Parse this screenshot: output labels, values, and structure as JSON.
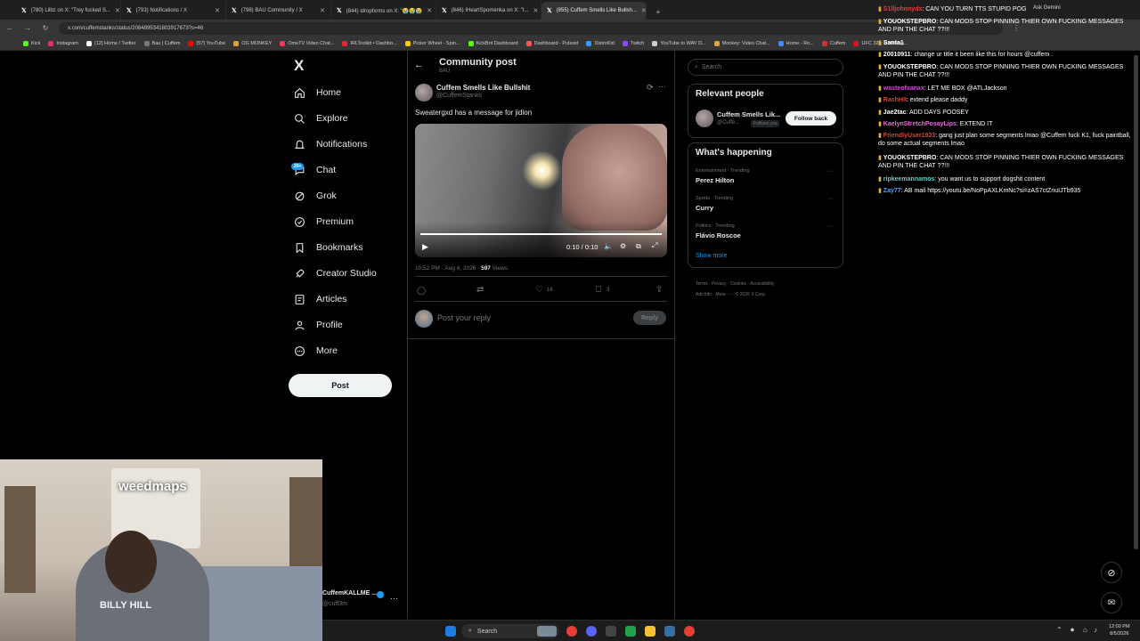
{
  "browser": {
    "tabs": [
      {
        "label": "(780) Lilbz on X: \"Trey fucked S...",
        "active": false
      },
      {
        "label": "(793) Notifications / X",
        "active": false
      },
      {
        "label": "(798) BAU Community / X",
        "active": false
      },
      {
        "label": "(844) idropfxrms on X: \"😭😭😭",
        "active": false
      },
      {
        "label": "(846) IHeartSpomenka on X: \"I...",
        "active": false
      },
      {
        "label": "(855) Cuffem Smells Like Bullsh...",
        "active": true
      }
    ],
    "url": "x.com/cuffemstanks/status/2084895341803917673?s=46",
    "bookmarks": [
      "Kick",
      "Instagram",
      "(12) Home / Twitter",
      "Bau | Cuffem",
      "(57) YouTube",
      "OG MONKEY",
      "OmeTV Video Chat...",
      "IRLToolkit • Dashbo...",
      "Picker Wheel - Spin...",
      "KickBot Dashboard",
      "Dashboard - Pulsoid",
      "DistroKid",
      "Twitch",
      "YouTube to WAV D...",
      "Monkey: Video Chat...",
      "Home - Ro...",
      "Cuffem",
      "UFC 326: Holloway..."
    ],
    "all_bookmarks": "All Bookmarks",
    "ask_gemini": "Ask Gemini"
  },
  "nav": {
    "logo": "X",
    "items": [
      {
        "label": "Home",
        "icon": "home-icon"
      },
      {
        "label": "Explore",
        "icon": "search-icon"
      },
      {
        "label": "Notifications",
        "icon": "bell-icon"
      },
      {
        "label": "Chat",
        "icon": "chat-icon"
      },
      {
        "label": "Grok",
        "icon": "grok-icon"
      },
      {
        "label": "Premium",
        "icon": "premium-icon"
      },
      {
        "label": "Bookmarks",
        "icon": "bookmark-icon"
      },
      {
        "label": "Creator Studio",
        "icon": "rocket-icon"
      },
      {
        "label": "Articles",
        "icon": "article-icon"
      },
      {
        "label": "Profile",
        "icon": "person-icon"
      },
      {
        "label": "More",
        "icon": "more-icon"
      }
    ],
    "chat_badge": "20+",
    "post_label": "Post",
    "account_name": "CuffemKALLME ...",
    "account_handle": "@cuff3m"
  },
  "post": {
    "header_title": "Community post",
    "header_sub": "BAU",
    "author_name": "Cuffem Smells Like Bullshit",
    "author_handle": "@CuffemStanks",
    "text": "Sweatergxd has a message for jidion",
    "video_time": "0:10 / 0:10",
    "video_progress": 1.0,
    "timestamp": "10:52 PM · Aug 4, 2026 · ",
    "views_count": "597",
    "views_label": " Views",
    "likes": "16",
    "bookmarks": "3",
    "reply_placeholder": "Post your reply",
    "reply_button": "Reply"
  },
  "right": {
    "search_placeholder": "Search",
    "relevant_title": "Relevant people",
    "relevant_name": "Cuffem Smells Lik...",
    "relevant_handle": "@Cuffe...",
    "follows_you": "Follows you",
    "follow_back": "Follow back",
    "happening_title": "What's happening",
    "trends": [
      {
        "context": "Entertainment · Trending",
        "name": "Perez Hilton"
      },
      {
        "context": "Sports · Trending",
        "name": "Curry"
      },
      {
        "context": "Politics · Trending",
        "name": "Flávio Roscoe"
      }
    ],
    "show_more": "Show more",
    "footer": [
      "Terms",
      "Privacy",
      "Cookies",
      "Accessibility",
      "Ads info",
      "More ···",
      "© 2026 X Corp."
    ]
  },
  "chat": [
    {
      "name": "S1lljohnnyds",
      "color": "#e0413d",
      "msg": "CAN YOU TURN TTS STUPID POG"
    },
    {
      "name": "YOUOKSTEPBRO",
      "color": "#ffffff",
      "msg": "CAN MODS STOP PINNING THIER OWN FUCKING MESSAGES AND PIN THE CHAT ??!!!"
    },
    {
      "name": "Santa1",
      "color": "#ffffff",
      "msg": ""
    },
    {
      "name": "20010911",
      "color": "#ffffff",
      "msg": "change ur title it been like this for hours @cuffem ."
    },
    {
      "name": "YOUOKSTEPBRO",
      "color": "#ffffff",
      "msg": "CAN MODS STOP PINNING THIER OWN FUCKING MESSAGES AND PIN THE CHAT ??!!!"
    },
    {
      "name": "wasteofxanax",
      "color": "#d14ad1",
      "msg": "LET ME BOX @ATLJackson"
    },
    {
      "name": "RachHII",
      "color": "#e0413d",
      "msg": "extend please daddy"
    },
    {
      "name": "Jae2tac",
      "color": "#ffffff",
      "msg": "ADD DAYS POOSEY"
    },
    {
      "name": "KaelynStretchPosayLips",
      "color": "#e86ad6",
      "msg": "EXTEND IT"
    },
    {
      "name": "FriendlyUser1923",
      "color": "#e0413d",
      "msg": "gang just plan some segments lmao @Cuffem fuck K1, fuck paintball, do some actual segments lmao"
    },
    {
      "name": "YOUOKSTEPBRO",
      "color": "#ffffff",
      "msg": "CAN MODS STOP PINNING THIER OWN FUCKING MESSAGES AND PIN THE CHAT ??!!!"
    },
    {
      "name": "ripkeemannamos",
      "color": "#5fd3c9",
      "msg": "you want us to support dogshit content"
    },
    {
      "name": "Zay77",
      "color": "#4aa3ff",
      "msg": "AB mail https://youtu.be/NoPpAXLKmNc?si=zAS7ctZnuIJTb935"
    }
  ],
  "taskbar": {
    "search_label": "Search",
    "time": "12:00 PM",
    "date": "8/5/2026"
  },
  "webcam": {
    "sign_text": "weedmaps",
    "shirt_text": "BILLY HILL"
  },
  "colors": {
    "x_blue": "#1d9bf0",
    "border": "#2f3336",
    "muted": "#71767b"
  }
}
